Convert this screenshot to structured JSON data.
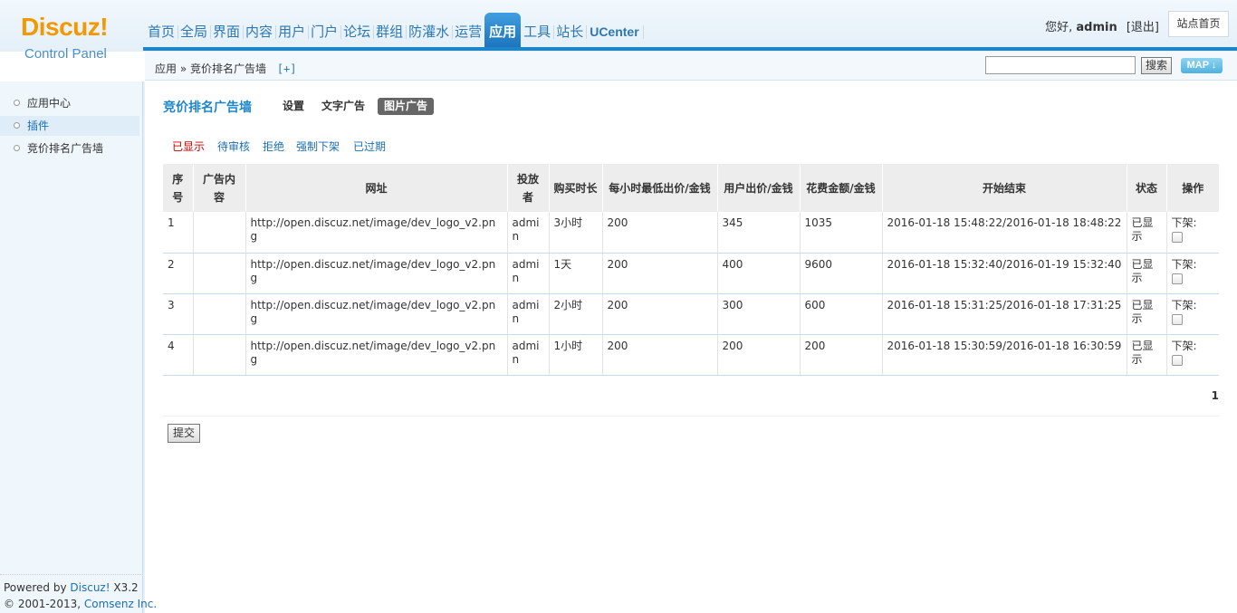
{
  "logo": {
    "brand": "Discuz!",
    "subtitle": "Control Panel"
  },
  "nav": [
    {
      "label": "首页"
    },
    {
      "label": "全局"
    },
    {
      "label": "界面"
    },
    {
      "label": "内容"
    },
    {
      "label": "用户"
    },
    {
      "label": "门户"
    },
    {
      "label": "论坛"
    },
    {
      "label": "群组"
    },
    {
      "label": "防灌水"
    },
    {
      "label": "运营"
    },
    {
      "label": "应用",
      "active": true
    },
    {
      "label": "工具"
    },
    {
      "label": "站长"
    },
    {
      "label": "UCenter"
    }
  ],
  "user": {
    "greeting": "您好,",
    "name": "admin",
    "logout": "[退出]"
  },
  "site_home": "站点首页",
  "breadcrumb": {
    "text": "应用 » 竞价排名广告墙",
    "plus": "[+]"
  },
  "search": {
    "button": "搜索",
    "value": ""
  },
  "map_button": "MAP ↓",
  "sidebar": {
    "items": [
      {
        "label": "应用中心"
      },
      {
        "label": "插件",
        "active": true
      },
      {
        "label": "竞价排名广告墙"
      }
    ],
    "footer_powered": "Powered by",
    "footer_product": "Discuz!",
    "footer_version": "X3.2",
    "footer_copyright": "© 2001-2013,",
    "footer_company": "Comsenz Inc."
  },
  "main": {
    "title": "竞价排名广告墙",
    "tabs": [
      {
        "label": "设置"
      },
      {
        "label": "文字广告"
      },
      {
        "label": "图片广告",
        "active": true
      }
    ],
    "filters": [
      {
        "label": "已显示",
        "active": true
      },
      {
        "label": "待审核"
      },
      {
        "label": "拒绝"
      },
      {
        "label": "强制下架"
      },
      {
        "label": "已过期"
      }
    ],
    "table": {
      "headers": [
        "序号",
        "广告内容",
        "网址",
        "投放者",
        "购买时长",
        "每小时最低出价/金钱",
        "用户出价/金钱",
        "花费金额/金钱",
        "开始结束",
        "状态",
        "操作"
      ],
      "rows": [
        [
          "1",
          "",
          "http://open.discuz.net/image/dev_logo_v2.png",
          "admin",
          "3小时",
          "200",
          "345",
          "1035",
          "2016-01-18 15:48:22/2016-01-18 18:48:22",
          "已显示",
          "下架:"
        ],
        [
          "2",
          "",
          "http://open.discuz.net/image/dev_logo_v2.png",
          "admin",
          "1天",
          "200",
          "400",
          "9600",
          "2016-01-18 15:32:40/2016-01-19 15:32:40",
          "已显示",
          "下架:"
        ],
        [
          "3",
          "",
          "http://open.discuz.net/image/dev_logo_v2.png",
          "admin",
          "2小时",
          "200",
          "300",
          "600",
          "2016-01-18 15:31:25/2016-01-18 17:31:25",
          "已显示",
          "下架:"
        ],
        [
          "4",
          "",
          "http://open.discuz.net/image/dev_logo_v2.png",
          "admin",
          "1小时",
          "200",
          "200",
          "200",
          "2016-01-18 15:30:59/2016-01-18 16:30:59",
          "已显示",
          "下架:"
        ]
      ]
    },
    "pager": "1",
    "submit": "提交"
  }
}
